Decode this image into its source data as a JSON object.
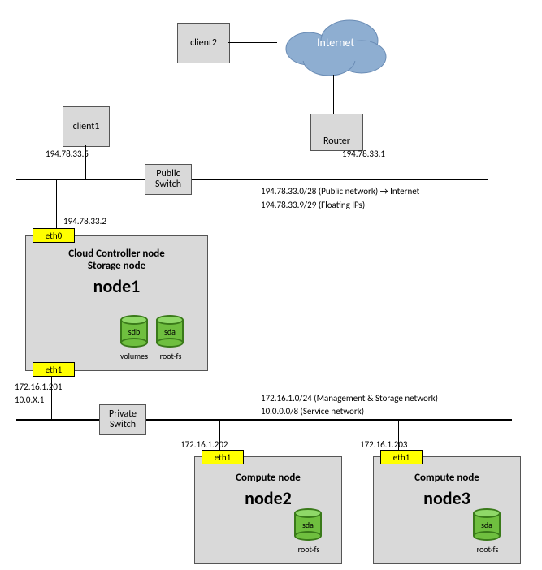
{
  "cloud": {
    "label": "Internet"
  },
  "client2": {
    "label": "client2"
  },
  "client1": {
    "label": "client1",
    "ip": "194.78.33.5"
  },
  "router": {
    "label": "Router",
    "ip": "194.78.33.1"
  },
  "public_switch": {
    "label1": "Public",
    "label2": "Switch"
  },
  "public_net": {
    "line1": "194.78.33.0/28 (Public network) → Internet",
    "line2": "194.78.33.9/29 (Floating IPs)"
  },
  "node1": {
    "eth0": "eth0",
    "eth0_ip": "194.78.33.2",
    "title1": "Cloud Controller node",
    "title2": "Storage node",
    "name": "node1",
    "disk1": "sdb",
    "disk2": "sda",
    "disk1_lbl": "volumes",
    "disk2_lbl": "root-fs",
    "eth1": "eth1",
    "eth1_ip1": "172.16.1.201",
    "eth1_ip2": "10.0.X.1"
  },
  "private_switch": {
    "label1": "Private",
    "label2": "Switch"
  },
  "private_net": {
    "line1": "172.16.1.0/24 (Management & Storage network)",
    "line2": "10.0.0.0/8 (Service network)"
  },
  "node2": {
    "eth1": "eth1",
    "eth1_ip": "172.16.1.202",
    "title": "Compute node",
    "name": "node2",
    "disk": "sda",
    "disk_lbl": "root-fs"
  },
  "node3": {
    "eth1": "eth1",
    "eth1_ip": "172.16.1.203",
    "title": "Compute node",
    "name": "node3",
    "disk": "sda",
    "disk_lbl": "root-fs"
  },
  "chart_data": {
    "type": "table",
    "title": "Network topology",
    "nodes": [
      {
        "id": "Internet",
        "type": "cloud"
      },
      {
        "id": "client2",
        "type": "client"
      },
      {
        "id": "client1",
        "type": "client",
        "ip": "194.78.33.5"
      },
      {
        "id": "Router",
        "type": "router",
        "ip": "194.78.33.1"
      },
      {
        "id": "PublicSwitch",
        "type": "switch",
        "networks": [
          "194.78.33.0/28 (Public network) → Internet",
          "194.78.33.9/29 (Floating IPs)"
        ]
      },
      {
        "id": "node1",
        "type": "controller+storage",
        "eth0": "194.78.33.2",
        "eth1": [
          "172.16.1.201",
          "10.0.X.1"
        ],
        "disks": [
          {
            "dev": "sdb",
            "role": "volumes"
          },
          {
            "dev": "sda",
            "role": "root-fs"
          }
        ]
      },
      {
        "id": "PrivateSwitch",
        "type": "switch",
        "networks": [
          "172.16.1.0/24 (Management & Storage network)",
          "10.0.0.0/8 (Service network)"
        ]
      },
      {
        "id": "node2",
        "type": "compute",
        "eth1": "172.16.1.202",
        "disks": [
          {
            "dev": "sda",
            "role": "root-fs"
          }
        ]
      },
      {
        "id": "node3",
        "type": "compute",
        "eth1": "172.16.1.203",
        "disks": [
          {
            "dev": "sda",
            "role": "root-fs"
          }
        ]
      }
    ],
    "edges": [
      [
        "client2",
        "Internet"
      ],
      [
        "Internet",
        "Router"
      ],
      [
        "Router",
        "PublicSwitch"
      ],
      [
        "client1",
        "PublicSwitch"
      ],
      [
        "node1.eth0",
        "PublicSwitch"
      ],
      [
        "node1.eth1",
        "PrivateSwitch"
      ],
      [
        "node2.eth1",
        "PrivateSwitch"
      ],
      [
        "node3.eth1",
        "PrivateSwitch"
      ]
    ]
  }
}
